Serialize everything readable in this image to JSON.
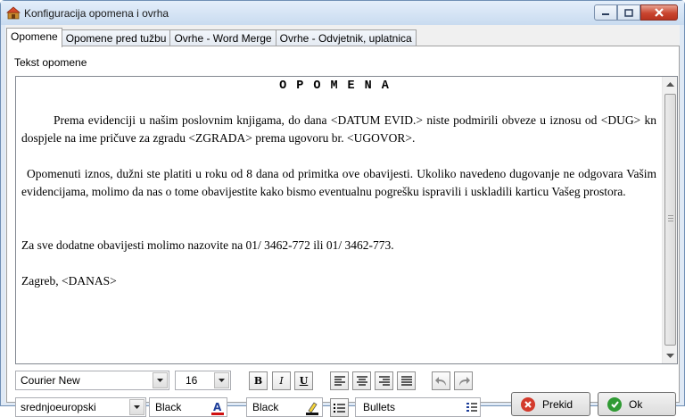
{
  "window": {
    "title": "Konfiguracija opomena i ovrha"
  },
  "tabs": [
    {
      "label": "Opomene",
      "active": true
    },
    {
      "label": "Opomene pred tužbu",
      "active": false
    },
    {
      "label": "Ovrhe - Word Merge",
      "active": false
    },
    {
      "label": "Ovrhe - Odvjetnik, uplatnica",
      "active": false
    }
  ],
  "section_label": "Tekst opomene",
  "document": {
    "title": "OPOMENA",
    "paragraph1": "Prema evidenciji u našim poslovnim knjigama, do dana <DATUM EVID.> niste podmirili obveze u iznosu od <DUG> kn dospjele na ime pričuve za zgradu <ZGRADA> prema ugovoru br. <UGOVOR>.",
    "paragraph2": "Opomenuti iznos, dužni ste platiti u roku od 8 dana od primitka ove obavijesti. Ukoliko navedeno dugovanje ne odgovara Vašim evidencijama, molimo da nas o tome obavijestite kako bismo eventualnu pogrešku ispravili i uskladili karticu Vašeg prostora.",
    "paragraph3": "Za sve dodatne obavijesti molimo nazovite na 01/ 3462-772 ili 01/ 3462-773.",
    "paragraph4": "Zagreb, <DANAS>"
  },
  "toolbar": {
    "font_name": "Courier New",
    "font_size": "16",
    "charset": "srednjoeuropski",
    "font_color": "Black",
    "highlight_color": "Black",
    "list_style": "Bullets",
    "bold_label": "B",
    "italic_label": "I",
    "underline_label": "U"
  },
  "buttons": {
    "cancel_label": "Prekid",
    "ok_label": "Ok"
  },
  "colors": {
    "accent": "#3165c7",
    "close_red": "#c9452f",
    "ok_green": "#2f9a33",
    "cancel_red": "#d33a2c"
  }
}
